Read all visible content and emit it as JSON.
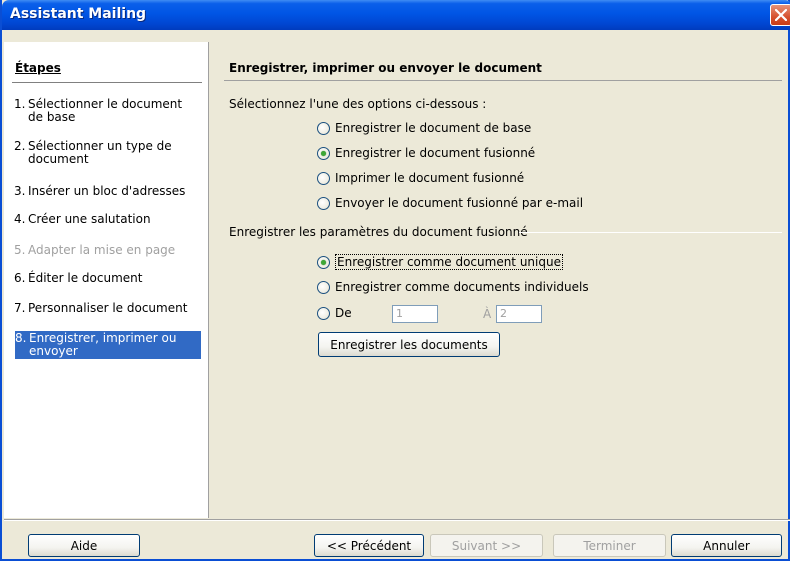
{
  "window": {
    "title": "Assistant Mailing"
  },
  "sidebar": {
    "header": "Étapes",
    "steps": [
      {
        "num": "1.",
        "label": "Sélectionner le document de base",
        "state": "normal"
      },
      {
        "num": "2.",
        "label": "Sélectionner un type de document",
        "state": "normal"
      },
      {
        "num": "3.",
        "label": "Insérer un bloc d'adresses",
        "state": "normal"
      },
      {
        "num": "4.",
        "label": "Créer une salutation",
        "state": "normal"
      },
      {
        "num": "5.",
        "label": "Adapter la mise en page",
        "state": "disabled"
      },
      {
        "num": "6.",
        "label": "Éditer le document",
        "state": "normal"
      },
      {
        "num": "7.",
        "label": "Personnaliser le document",
        "state": "normal"
      },
      {
        "num": "8.",
        "label": "Enregistrer, imprimer ou envoyer",
        "state": "active"
      }
    ]
  },
  "main": {
    "title": "Enregistrer, imprimer ou envoyer le document",
    "options_label": "Sélectionnez l'une des options ci-dessous :",
    "options": [
      {
        "label": "Enregistrer le document de base",
        "checked": false
      },
      {
        "label": "Enregistrer le document fusionné",
        "checked": true
      },
      {
        "label": "Imprimer le document fusionné",
        "checked": false
      },
      {
        "label": "Envoyer le document fusionné par e-mail",
        "checked": false
      }
    ],
    "group_label": "Enregistrer les paramètres du document fusionné",
    "save_options": [
      {
        "label": "Enregistrer comme document unique",
        "checked": true
      },
      {
        "label": "Enregistrer comme documents individuels",
        "checked": false
      },
      {
        "label": "De",
        "checked": false
      }
    ],
    "from_value": "1",
    "to_label": "À",
    "to_value": "2",
    "save_button": "Enregistrer les documents"
  },
  "footer": {
    "help": "Aide",
    "previous": "<< Précédent",
    "next": "Suivant >>",
    "finish": "Terminer",
    "cancel": "Annuler"
  },
  "colors": {
    "titlebar": "#0055e5",
    "selection": "#316ac5",
    "radio_checked": "#3ea736"
  }
}
